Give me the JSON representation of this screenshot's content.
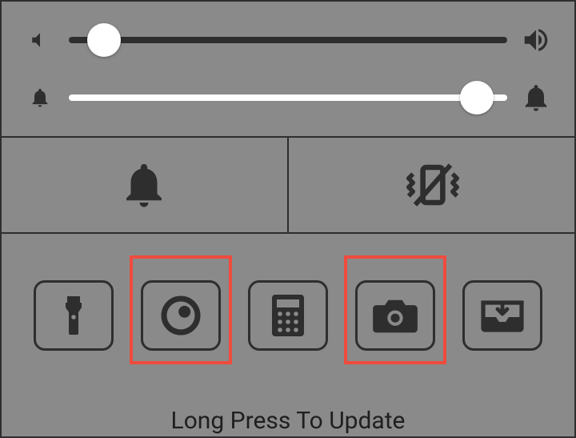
{
  "sliders": {
    "volume": {
      "value": 8,
      "min": 0,
      "max": 100,
      "icon_low": "volume-low-icon",
      "icon_high": "volume-high-icon"
    },
    "notification": {
      "value": 93,
      "min": 0,
      "max": 100,
      "icon_low": "bell-small-icon",
      "icon_high": "bell-large-icon"
    }
  },
  "modes": {
    "ring": {
      "icon": "bell-icon",
      "active": true
    },
    "vibrate": {
      "icon": "vibrate-off-icon",
      "active": false
    }
  },
  "shortcuts": [
    {
      "name": "flashlight",
      "icon": "flashlight-icon",
      "highlighted": false
    },
    {
      "name": "timer",
      "icon": "timer-icon",
      "highlighted": true
    },
    {
      "name": "calculator",
      "icon": "calculator-icon",
      "highlighted": false
    },
    {
      "name": "camera",
      "icon": "camera-icon",
      "highlighted": true
    },
    {
      "name": "downloads",
      "icon": "inbox-download-icon",
      "highlighted": false
    }
  ],
  "footer_text": "Long Press To Update",
  "colors": {
    "background": "#8a8a8a",
    "dark": "#2e2e2e",
    "highlight": "#ef4b3e",
    "white": "#ffffff"
  }
}
